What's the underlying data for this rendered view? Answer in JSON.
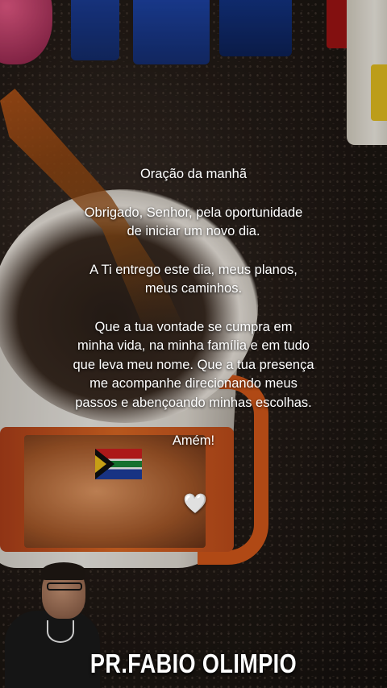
{
  "prayer": {
    "title": "Oração da manhã",
    "p1_l1": "Obrigado, Senhor, pela oportunidade",
    "p1_l2": "de iniciar um novo dia.",
    "p2_l1": "A Ti entrego este dia, meus planos,",
    "p2_l2": "meus caminhos.",
    "p3_l1": "Que a tua vontade se cumpra em",
    "p3_l2": "minha vida, na minha família e em tudo",
    "p3_l3": "que leva meu nome. Que a tua presença",
    "p3_l4": "me acompanhe direcionando meus",
    "p3_l5": "passos e abençoando minhas escolhas.",
    "closing": "Amém!",
    "heart": "🤍"
  },
  "signature": "PR.FABIO OLIMPIO",
  "colors": {
    "text": "#ffffff",
    "mug_accent": "#d75a1a",
    "coffee": "#9a4a12"
  }
}
